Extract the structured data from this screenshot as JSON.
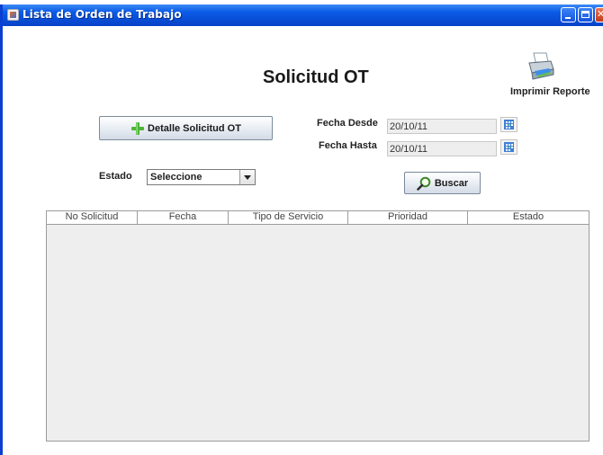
{
  "window": {
    "title": "Lista de Orden de Trabajo"
  },
  "header": {
    "title": "Solicitud OT",
    "print_label": "Imprimir Reporte"
  },
  "form": {
    "detalle_button": "Detalle Solicitud OT",
    "fecha_desde_label": "Fecha Desde",
    "fecha_desde_value": "20/10/11",
    "fecha_hasta_label": "Fecha Hasta",
    "fecha_hasta_value": "20/10/11",
    "estado_label": "Estado",
    "estado_selected": "Seleccione",
    "buscar_button": "Buscar"
  },
  "table": {
    "columns": [
      "No Solicitud",
      "Fecha",
      "Tipo de Servicio",
      "Prioridad",
      "Estado"
    ],
    "rows": []
  },
  "icons": {
    "print": "printer-icon",
    "detalle": "plus-icon",
    "buscar": "search-icon",
    "calendar": "calendar-icon"
  },
  "colors": {
    "titlebar": "#0a5be6",
    "accent_green": "#4fb43a"
  }
}
